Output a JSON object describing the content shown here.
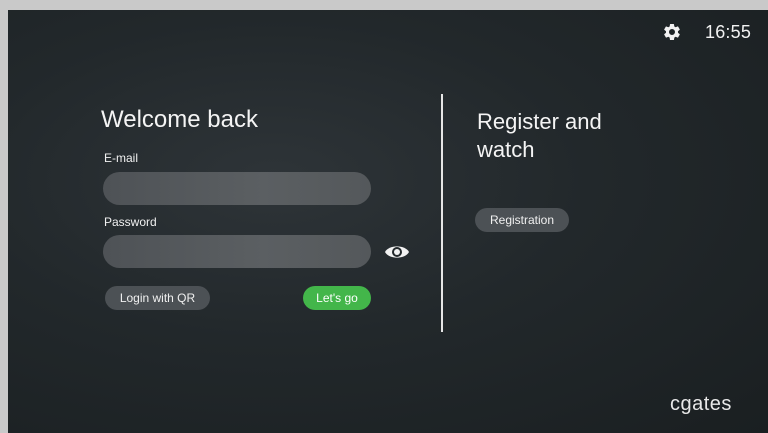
{
  "status_bar": {
    "settings_icon": "gear-icon",
    "time": "16:55"
  },
  "login": {
    "title": "Welcome back",
    "email_label": "E-mail",
    "email_value": "",
    "password_label": "Password",
    "password_value": "",
    "show_password_icon": "eye-icon",
    "qr_button": "Login with QR",
    "submit_button": "Let's go"
  },
  "register": {
    "title": "Register and watch",
    "button": "Registration"
  },
  "brand": {
    "logo_text": "cgates"
  },
  "colors": {
    "background": "#22282b",
    "primary_button": "#43b64a",
    "secondary_button": "#4c5155",
    "input_fill": "#55595c",
    "text": "#f4f4f4"
  }
}
